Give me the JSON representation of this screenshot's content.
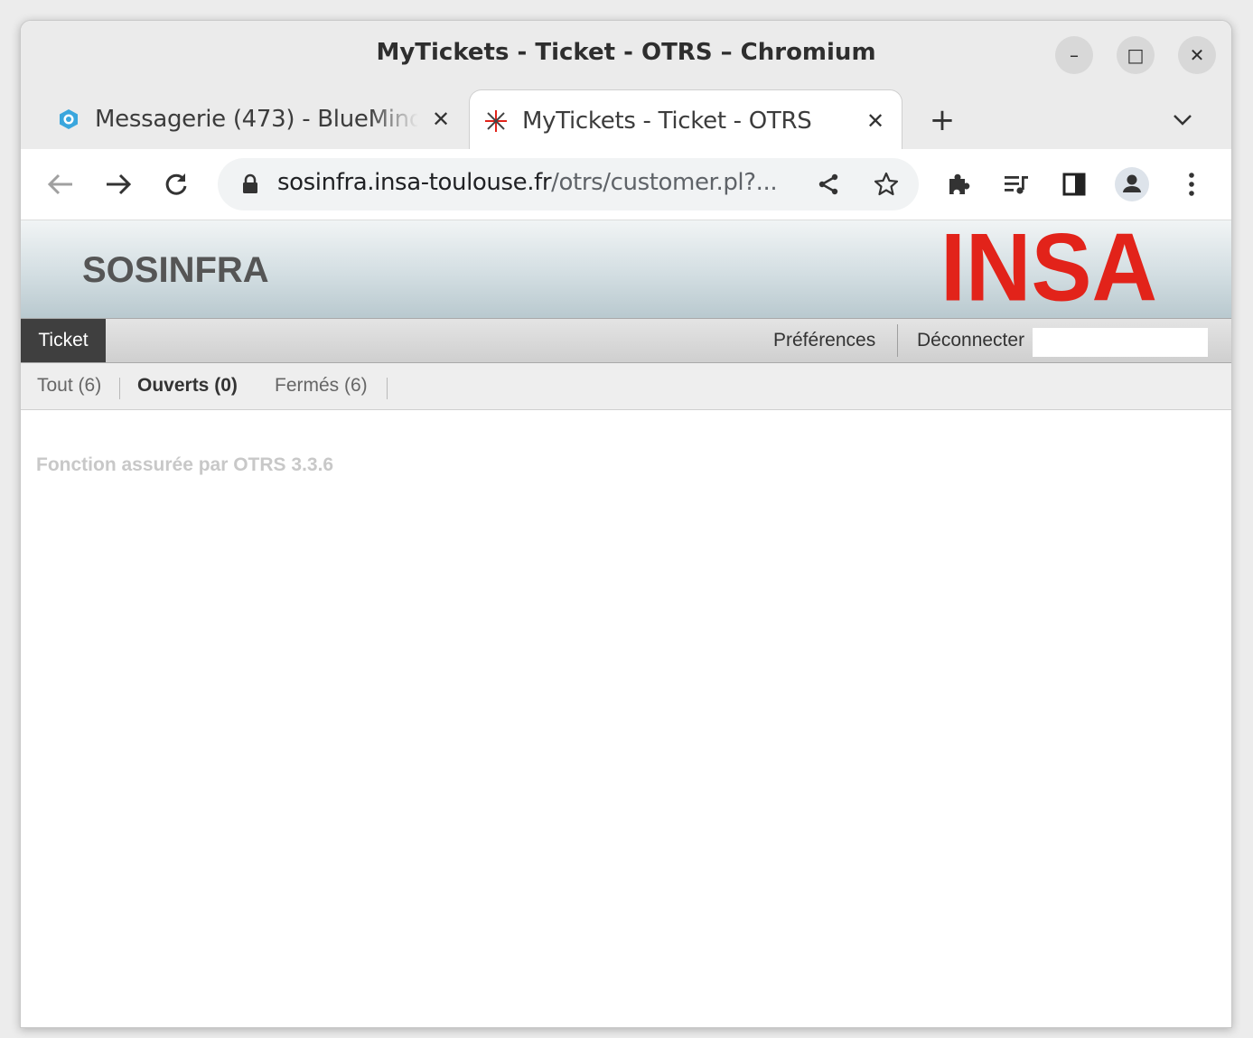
{
  "window": {
    "title": "MyTickets - Ticket - OTRS – Chromium",
    "minimize_label": "–",
    "maximize_label": "□",
    "close_label": "✕"
  },
  "tabs": [
    {
      "title": "Messagerie (473) - BlueMind",
      "icon": "bluemind-icon",
      "active": false,
      "close": "✕"
    },
    {
      "title": "MyTickets - Ticket - OTRS",
      "icon": "otrs-icon",
      "active": true,
      "close": "✕"
    }
  ],
  "tabstrip": {
    "new_tab": "+"
  },
  "toolbar": {
    "url_host": "sosinfra.insa-toulouse.fr",
    "url_path": "/otrs/customer.pl?..."
  },
  "page": {
    "site_name": "SOSINFRA",
    "logo_text": "INSA",
    "brand_color": "#e2231a",
    "nav": {
      "ticket": "Ticket",
      "preferences": "Préférences",
      "logout": "Déconnecter"
    },
    "filters": {
      "all": "Tout (6)",
      "open": "Ouverts (0)",
      "closed": "Fermés (6)"
    },
    "powered_by": "Fonction assurée par OTRS 3.3.6"
  }
}
